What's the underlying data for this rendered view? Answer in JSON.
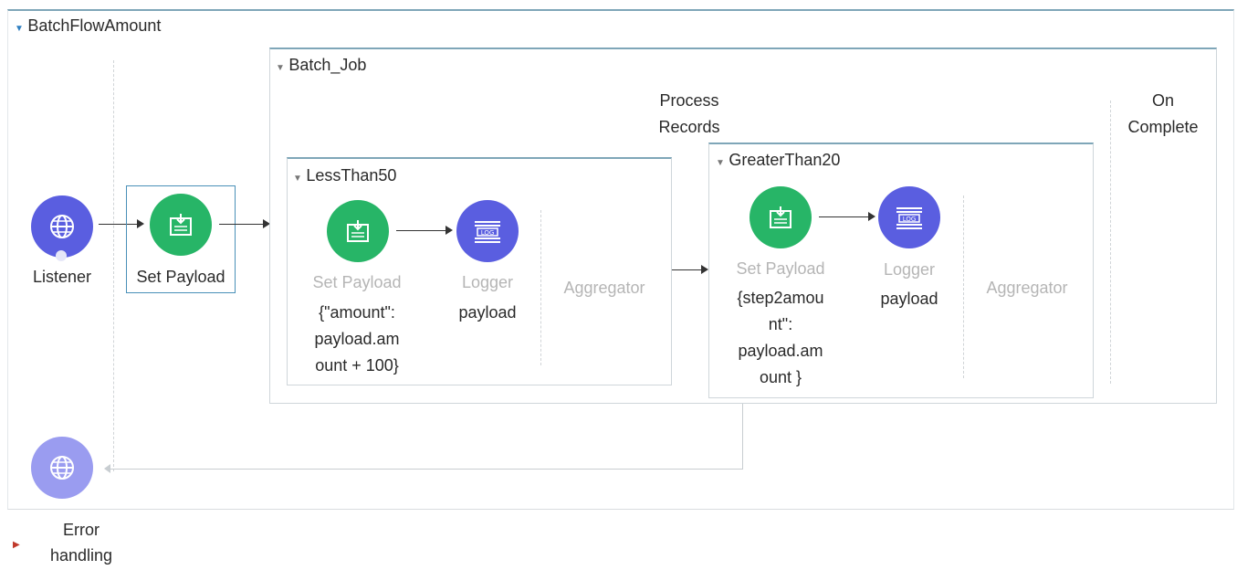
{
  "flow": {
    "title": "BatchFlowAmount",
    "listener_label": "Listener",
    "set_payload_label": "Set Payload"
  },
  "batch_job": {
    "title": "Batch_Job",
    "process_records_line1": "Process",
    "process_records_line2": "Records",
    "on_complete_line1": "On",
    "on_complete_line2": "Complete"
  },
  "step1": {
    "title": "LessThan50",
    "set_payload_label": "Set Payload",
    "set_payload_value": [
      "{\"amount\":",
      "payload.am",
      "ount + 100}"
    ],
    "logger_label": "Logger",
    "logger_value": "payload",
    "aggregator_label": "Aggregator"
  },
  "step2": {
    "title": "GreaterThan20",
    "set_payload_label": "Set Payload",
    "set_payload_value": [
      "{step2amou",
      "nt\":",
      "payload.am",
      "ount }"
    ],
    "logger_label": "Logger",
    "logger_value": "payload",
    "aggregator_label": "Aggregator"
  },
  "error_handling": {
    "line1": "Error",
    "line2": "handling"
  },
  "icons": {
    "listener": "globe-icon",
    "set_payload": "set-payload-icon",
    "logger": "log-icon"
  },
  "colors": {
    "green": "#27b567",
    "purple": "#5a5ee0",
    "accent_border": "#7fa6b8"
  }
}
